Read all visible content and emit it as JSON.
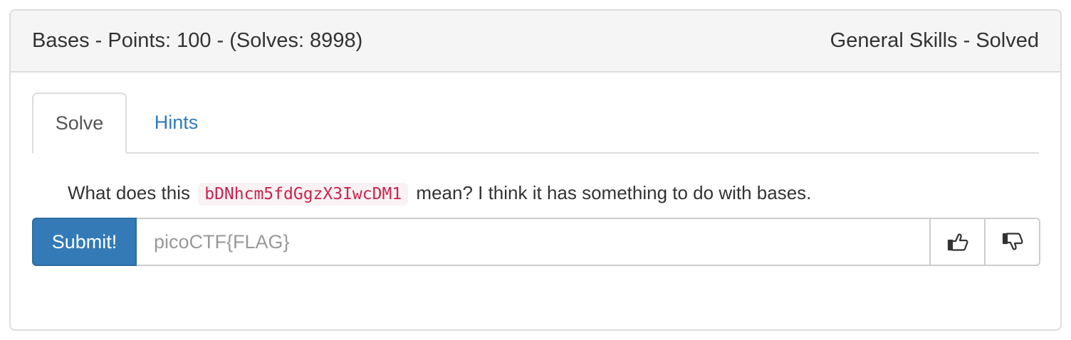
{
  "challenge": {
    "header_left": "Bases - Points: 100 - (Solves: 8998)",
    "header_right": "General Skills - Solved"
  },
  "tabs": [
    {
      "label": "Solve",
      "active": true
    },
    {
      "label": "Hints",
      "active": false
    }
  ],
  "question": {
    "prefix": "What does this",
    "code": "bDNhcm5fdGgzX3IwcDM1",
    "suffix": "mean? I think it has something to do with bases."
  },
  "form": {
    "submit_label": "Submit!",
    "flag_placeholder": "picoCTF{FLAG}",
    "flag_value": ""
  },
  "icons": {
    "thumbs_up": "thumbs-up-icon",
    "thumbs_down": "thumbs-down-icon"
  },
  "colors": {
    "primary": "#337ab7",
    "code_text": "#c7254e",
    "code_bg": "#f9f2f4",
    "heading_bg": "#f5f5f5"
  }
}
